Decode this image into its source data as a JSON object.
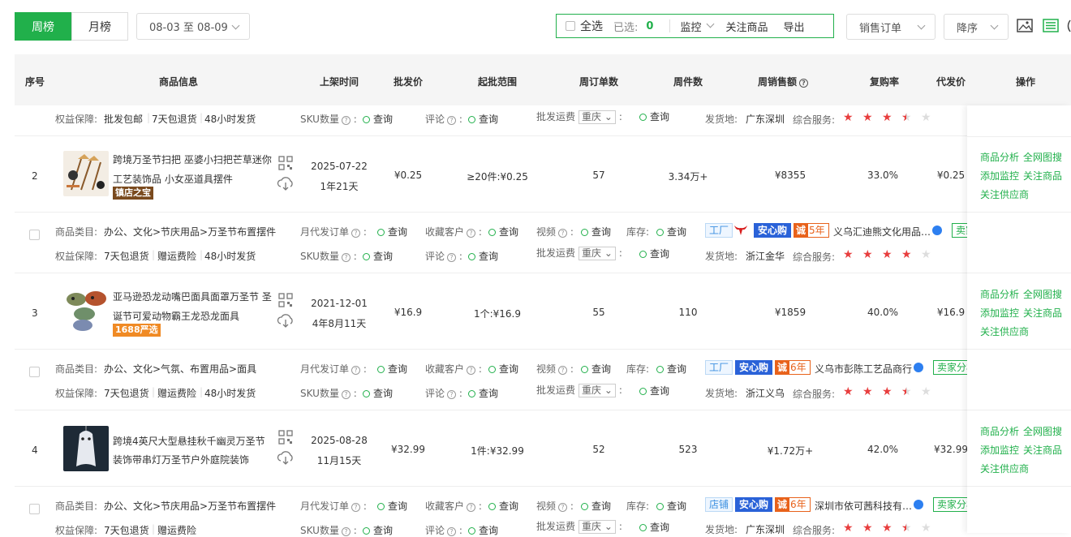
{
  "toolbar": {
    "tab_week": "周榜",
    "tab_month": "月榜",
    "date_range": "08-03 至 08-09",
    "select_all": "全选",
    "selected_label": "已选:",
    "selected_count": "0",
    "monitor": "监控",
    "follow": "关注商品",
    "export": "导出",
    "sort_field": "销售订单",
    "sort_order": "降序",
    "accent": "#21b04b"
  },
  "table": {
    "headers": [
      "序号",
      "商品信息",
      "上架时间",
      "批发价",
      "起批范围",
      "周订单数",
      "周件数",
      "周销售额",
      "复购率",
      "代发价",
      "操作"
    ]
  },
  "labels": {
    "category": "商品类目:",
    "guarantee": "权益保障:",
    "monthly_orders": "月代发订单",
    "favorites": "收藏客户",
    "video": "视频",
    "stock": "库存:",
    "sku": "SKU数量",
    "review": "评论",
    "freight": "批发运费",
    "query": "查询",
    "origin": "发货地:",
    "service": "综合服务:",
    "op_analysis": "商品分析",
    "op_search": "全网图搜",
    "op_monitor": "添加监控",
    "op_follow": "关注商品",
    "op_supplier": "关注供应商",
    "seller_analysis": "卖家分析"
  },
  "top_partial": {
    "guarantees": [
      "批发包邮",
      "7天包退货",
      "48小时发货"
    ],
    "city": "重庆",
    "origin": "广东深圳",
    "stars": 3.5
  },
  "rows": [
    {
      "index": "2",
      "title_line1": "跨境万圣节扫把 巫婆小扫把芒草迷你",
      "title_line2": "工艺装饰品 小女巫道具摆件",
      "badge": "镇店之宝",
      "list_date": "2025-07-22",
      "list_age": "1年21天",
      "price": "¥0.25",
      "min_range": "≥20件:¥0.25",
      "week_orders": "57",
      "week_pieces": "3.34万+",
      "week_sales": "¥8355",
      "repurchase": "33.0%",
      "dropship_price": "¥0.25",
      "category": "办公、文化>节庆用品>万圣节布置摆件",
      "guarantees": [
        "7天包退货",
        "赠运费险",
        "48小时发货"
      ],
      "shop_type": "工厂",
      "shop_badge": "安心购",
      "years_prefix": "诚",
      "years": "5年",
      "shop_name": "义乌汇迪熊文化用品…",
      "city": "重庆",
      "origin": "浙江金华",
      "stars": 4
    },
    {
      "index": "3",
      "title_line1": "亚马逊恐龙动嘴巴面具面罩万圣节 圣",
      "title_line2": "诞节可爱动物霸王龙恐龙面具",
      "badge": "1688严选",
      "list_date": "2021-12-01",
      "list_age": "4年8月11天",
      "price": "¥16.9",
      "min_range": "1个:¥16.9",
      "week_orders": "55",
      "week_pieces": "110",
      "week_sales": "¥1859",
      "repurchase": "40.0%",
      "dropship_price": "¥16.9",
      "category": "办公、文化>气氛、布置用品>面具",
      "guarantees": [
        "7天包退货",
        "赠运费险",
        "48小时发货"
      ],
      "shop_type": "工厂",
      "shop_badge": "安心购",
      "years_prefix": "诚",
      "years": "6年",
      "shop_name": "义乌市彭陈工艺品商行",
      "city": "重庆",
      "origin": "浙江义乌",
      "stars": 3.5
    },
    {
      "index": "4",
      "title_line1": "跨境4英尺大型悬挂秋千幽灵万圣节",
      "title_line2": "装饰带串灯万圣节户外庭院装饰",
      "badge": "",
      "list_date": "2025-08-28",
      "list_age": "11月15天",
      "price": "¥32.99",
      "min_range": "1件:¥32.99",
      "week_orders": "52",
      "week_pieces": "523",
      "week_sales": "¥1.72万+",
      "repurchase": "42.0%",
      "dropship_price": "¥32.99",
      "category": "办公、文化>节庆用品>万圣节布置摆件",
      "guarantees": [
        "7天包退货",
        "赠运费险"
      ],
      "shop_type": "店铺",
      "shop_badge": "安心购",
      "years_prefix": "诚",
      "years": "6年",
      "shop_name": "深圳市依可茜科技有…",
      "city": "重庆",
      "origin": "广东深圳",
      "stars": 3.5
    }
  ]
}
